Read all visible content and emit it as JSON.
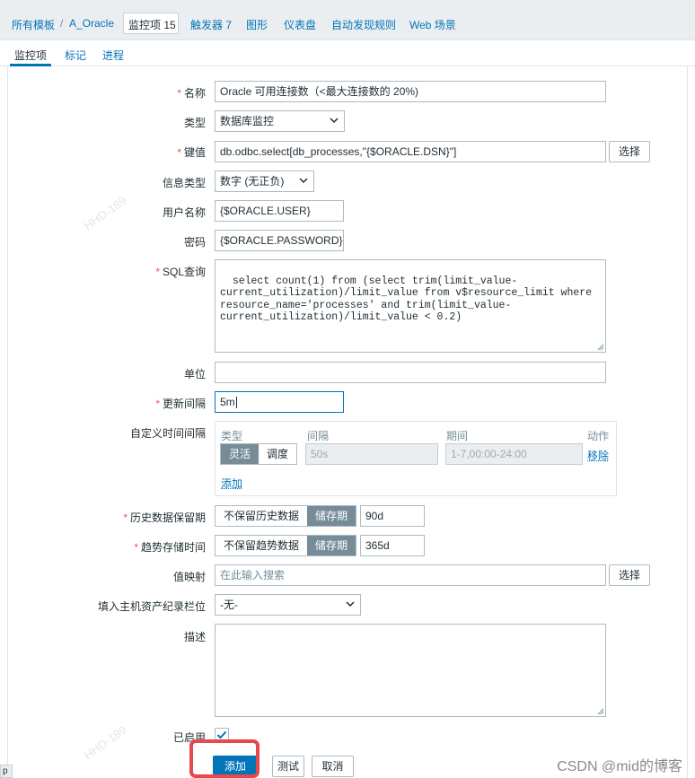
{
  "breadcrumbs": {
    "all_templates": "所有模板",
    "separator": "/",
    "template": "A_Oracle",
    "items": "监控项 15",
    "triggers": "触发器 7",
    "graphs": "图形",
    "dashboards": "仪表盘",
    "discovery": "自动发现规则",
    "web": "Web 场景"
  },
  "tabs": {
    "item": "监控项",
    "tags": "标记",
    "preprocessing": "进程"
  },
  "form": {
    "name_label": "名称",
    "name_value": "Oracle 可用连接数（<最大连接数的 20%)",
    "type_label": "类型",
    "type_value": "数据库监控",
    "key_label": "键值",
    "key_value": "db.odbc.select[db_processes,\"{$ORACLE.DSN}\"]",
    "select_label": "选择",
    "info_type_label": "信息类型",
    "info_type_value": "数字 (无正负)",
    "username_label": "用户名称",
    "username_value": "{$ORACLE.USER}",
    "password_label": "密码",
    "password_value": "{$ORACLE.PASSWORD}",
    "sql_label": "SQL查询",
    "sql_value": "select count(1) from (select trim(limit_value-current_utilization)/limit_value from v$resource_limit where resource_name='processes' and trim(limit_value-current_utilization)/limit_value < 0.2)",
    "units_label": "单位",
    "units_value": "",
    "interval_label": "更新间隔",
    "interval_value": "5m",
    "custom_label": "自定义时间间隔",
    "custom": {
      "col_type": "类型",
      "col_interval": "间隔",
      "col_period": "期间",
      "col_action": "动作",
      "flexible": "灵活",
      "scheduling": "调度",
      "interval_placeholder": "50s",
      "period_placeholder": "1-7,00:00-24:00",
      "remove": "移除",
      "add": "添加"
    },
    "history_label": "历史数据保留期",
    "history_no_keep": "不保留历史数据",
    "history_storage": "储存期",
    "history_value": "90d",
    "trends_label": "趋势存储时间",
    "trends_no_keep": "不保留趋势数据",
    "trends_storage": "储存期",
    "trends_value": "365d",
    "valuemap_label": "值映射",
    "valuemap_placeholder": "在此输入搜索",
    "valuemap_select": "选择",
    "inventory_label": "填入主机资产纪录栏位",
    "inventory_value": "-无-",
    "description_label": "描述",
    "description_value": "",
    "enabled_label": "已启用",
    "enabled": true
  },
  "actions": {
    "add": "添加",
    "test": "测试",
    "cancel": "取消"
  },
  "watermark": "HHD-189",
  "csdn": "CSDN @mid的博客",
  "corner": "p",
  "colors": {
    "link": "#0275b8",
    "required": "#e45959",
    "primary": "#0275b8",
    "highlight": "#e5484d"
  }
}
